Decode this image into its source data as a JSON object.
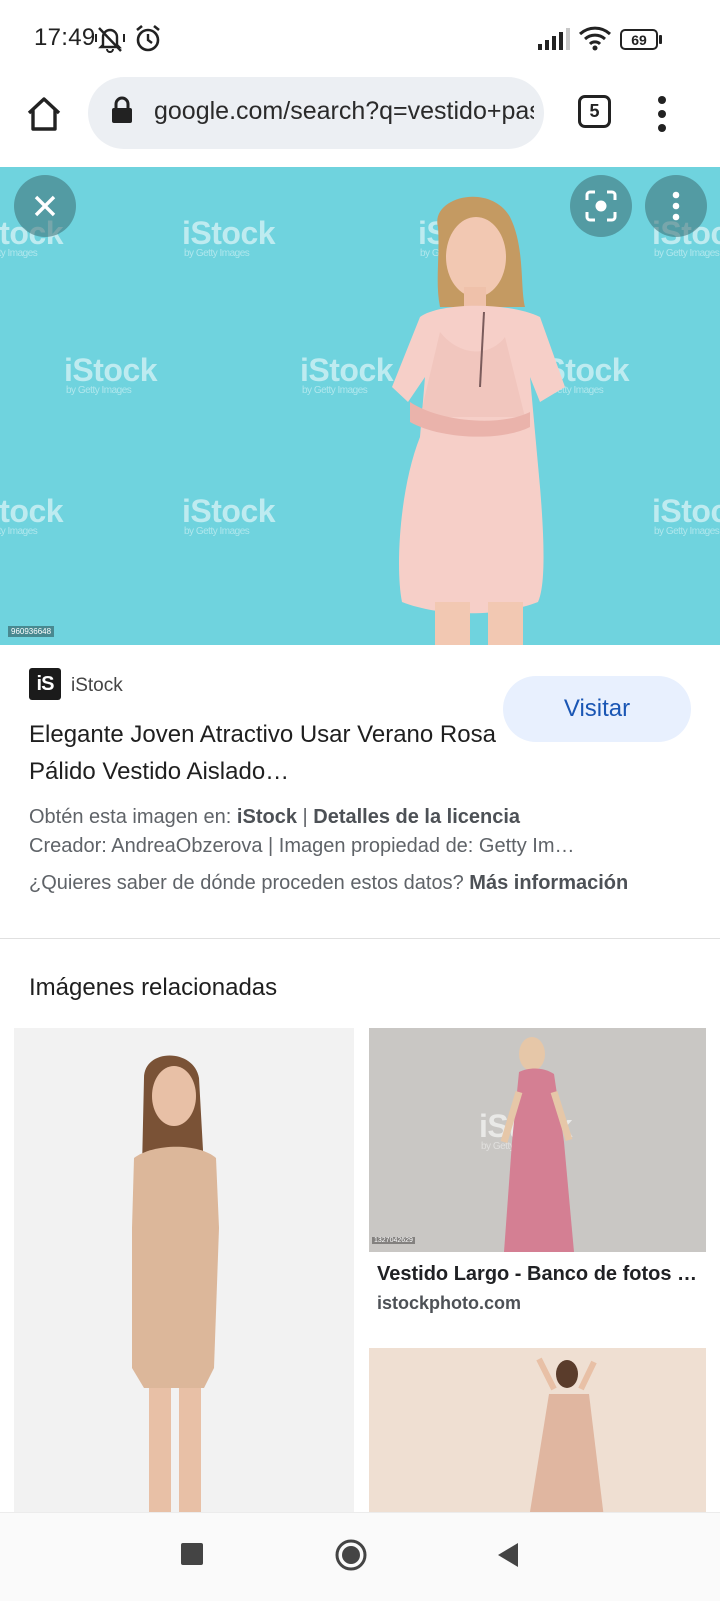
{
  "status_bar": {
    "time": "17:49",
    "battery": "69",
    "icons": [
      "mute-vibrate-icon",
      "alarm-icon",
      "signal-icon",
      "wifi-icon",
      "battery-icon"
    ]
  },
  "toolbar": {
    "url": "google.com/search?q=vestido+pastel",
    "tab_count": "5",
    "icons": [
      "home-icon",
      "lock-icon",
      "more-vert-icon"
    ]
  },
  "hero": {
    "watermark": "iStock",
    "watermark_sub": "by Getty Images",
    "image_id": "960936648",
    "icons": [
      "close-icon",
      "lens-icon",
      "more-vert-icon"
    ],
    "background_color": "#6fd3de"
  },
  "result": {
    "source_logo": "iS",
    "source_name": "iStock",
    "visit_label": "Visitar",
    "title": "Elegante Joven Atractivo Usar Verano Rosa Pálido Vestido Aislado…",
    "license_prefix": "Obtén esta imagen en: ",
    "license_source": "iStock",
    "license_sep": " | ",
    "license_link": "Detalles de la licencia",
    "creator_line": "Creador: AndreaObzerova | Imagen propiedad de: Getty Im…",
    "more_info_prefix": "¿Quieres saber de dónde proceden estos datos? ",
    "more_info_link": "Más información"
  },
  "related": {
    "heading": "Imágenes relacionadas",
    "items": [
      {
        "title": "",
        "site": ""
      },
      {
        "title": "Vestido Largo - Banco de fotos e…",
        "site": "istockphoto.com",
        "image_id": "1327042629"
      },
      {
        "title": "",
        "site": ""
      }
    ]
  },
  "nav_bar": {
    "icons": [
      "recents-icon",
      "home-circle-icon",
      "back-icon"
    ]
  },
  "colors": {
    "accent": "#1a56b4",
    "visit_bg": "#e8f0fe",
    "omnibox_bg": "#eceff3"
  }
}
